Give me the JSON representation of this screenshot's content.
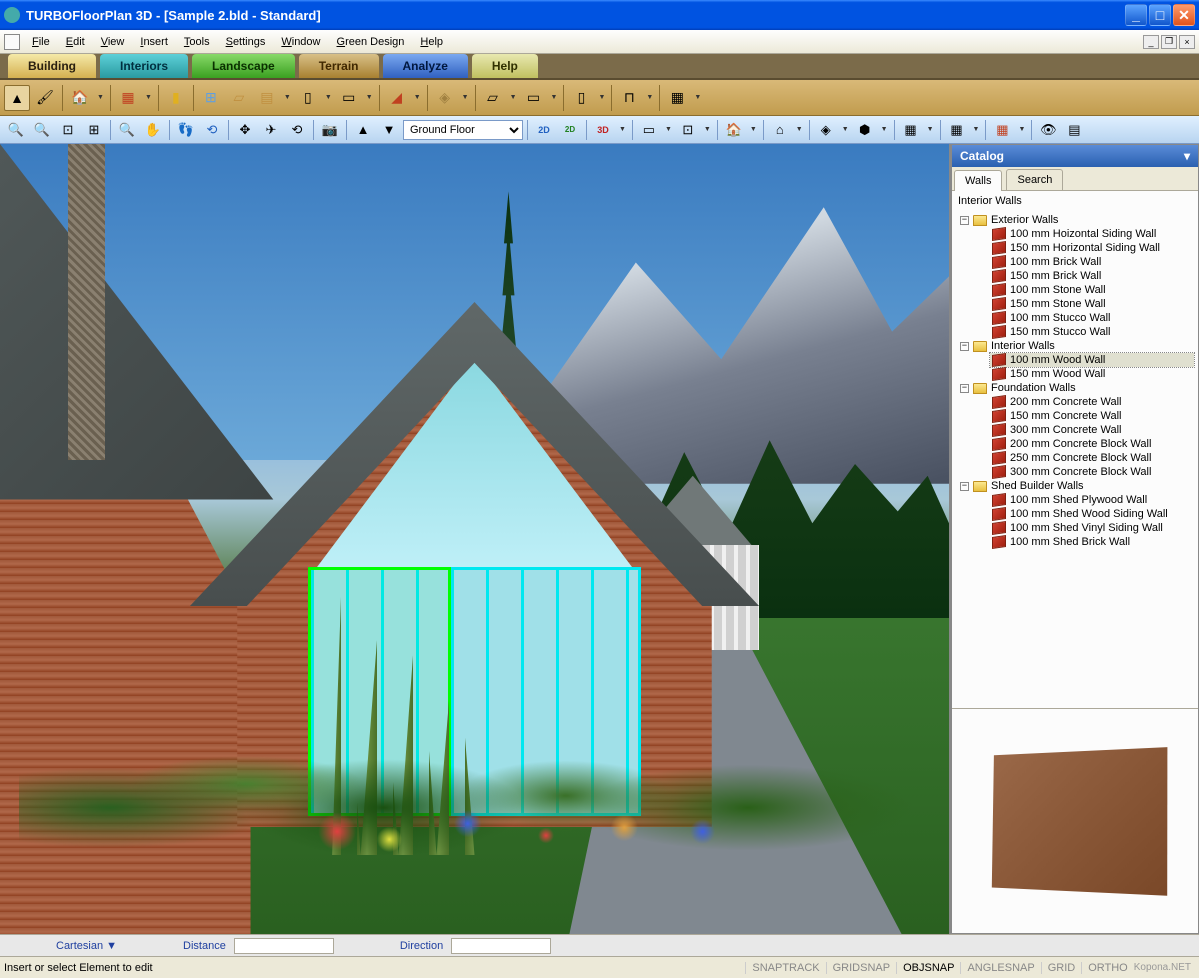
{
  "title": "TURBOFloorPlan 3D - [Sample 2.bld - Standard]",
  "menus": [
    "File",
    "Edit",
    "View",
    "Insert",
    "Tools",
    "Settings",
    "Window",
    "Green Design",
    "Help"
  ],
  "ribbonTabs": [
    {
      "label": "Building",
      "cls": "building"
    },
    {
      "label": "Interiors",
      "cls": "interiors"
    },
    {
      "label": "Landscape",
      "cls": "landscape"
    },
    {
      "label": "Terrain",
      "cls": "terrain"
    },
    {
      "label": "Analyze",
      "cls": "analyze"
    },
    {
      "label": "Help",
      "cls": "help"
    }
  ],
  "floorSelector": "Ground Floor",
  "catalog": {
    "title": "Catalog",
    "tabs": [
      "Walls",
      "Search"
    ],
    "activeTab": 0,
    "heading": "Interior Walls",
    "groups": [
      {
        "label": "Exterior Walls",
        "items": [
          "100 mm Hoizontal Siding Wall",
          "150 mm Horizontal Siding Wall",
          "100 mm Brick Wall",
          "150 mm Brick Wall",
          "100 mm Stone Wall",
          "150 mm Stone Wall",
          "100 mm Stucco Wall",
          "150 mm Stucco Wall"
        ]
      },
      {
        "label": "Interior Walls",
        "items": [
          "100 mm Wood Wall",
          "150 mm Wood Wall"
        ],
        "selected": 0
      },
      {
        "label": "Foundation Walls",
        "items": [
          "200 mm Concrete Wall",
          "150 mm Concrete Wall",
          "300 mm Concrete Wall",
          "200 mm Concrete Block Wall",
          "250 mm Concrete Block Wall",
          "300 mm Concrete Block Wall"
        ]
      },
      {
        "label": "Shed Builder Walls",
        "items": [
          "100 mm Shed Plywood Wall",
          "100 mm Shed Wood Siding Wall",
          "100 mm Shed Vinyl Siding Wall",
          "100 mm Shed Brick Wall"
        ]
      }
    ]
  },
  "coordBar": {
    "mode": "Cartesian",
    "distance": "Distance",
    "direction": "Direction"
  },
  "statusMsg": "Insert or select Element to edit",
  "statusToggles": [
    {
      "label": "SNAPTRACK",
      "active": false
    },
    {
      "label": "GRIDSNAP",
      "active": false
    },
    {
      "label": "OBJSNAP",
      "active": true
    },
    {
      "label": "ANGLESNAP",
      "active": false
    },
    {
      "label": "GRID",
      "active": false
    },
    {
      "label": "ORTHO",
      "active": false
    }
  ],
  "watermark": "Kopona.NET"
}
